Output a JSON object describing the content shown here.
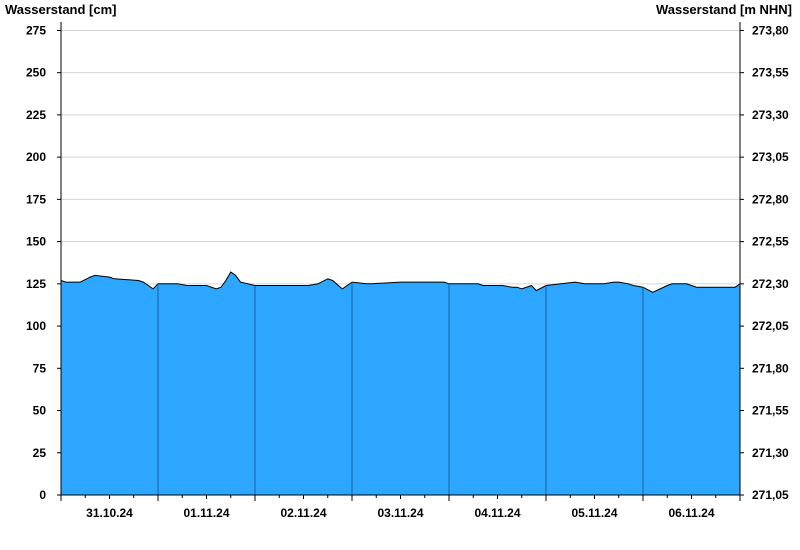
{
  "chart_data": {
    "type": "area",
    "left_axis_title": "Wasserstand [cm]",
    "right_axis_title": "Wasserstand [m NHN]",
    "ylim": [
      0,
      280
    ],
    "right_ylim": [
      271.05,
      273.85
    ],
    "y_ticks": [
      0,
      25,
      50,
      75,
      100,
      125,
      150,
      175,
      200,
      225,
      250,
      275
    ],
    "right_y_ticks": [
      "271,05",
      "271,30",
      "271,55",
      "271,80",
      "272,05",
      "272,30",
      "272,55",
      "272,80",
      "273,05",
      "273,30",
      "273,55",
      "273,80"
    ],
    "x_range_days": [
      0,
      7
    ],
    "x_ticks": [
      "31.10.24",
      "01.11.24",
      "02.11.24",
      "03.11.24",
      "04.11.24",
      "05.11.24",
      "06.11.24"
    ],
    "grid": "horizontal",
    "fill_color": "#2ca6ff",
    "series": [
      {
        "x": [
          0.0,
          0.05,
          0.2,
          0.3,
          0.35,
          0.5,
          0.55,
          0.8,
          0.85,
          0.9,
          0.95,
          1.0,
          1.2,
          1.3,
          1.45,
          1.5,
          1.6,
          1.65,
          1.7,
          1.75,
          1.8,
          1.85,
          2.0,
          2.1,
          2.2,
          2.3,
          2.45,
          2.55,
          2.65,
          2.75,
          2.8,
          2.9,
          3.0,
          3.15,
          3.2,
          3.5,
          3.7,
          3.75,
          3.95,
          4.0,
          4.3,
          4.35,
          4.55,
          4.65,
          4.7,
          4.75,
          4.85,
          4.9,
          5.0,
          5.3,
          5.4,
          5.6,
          5.7,
          5.75,
          5.85,
          5.9,
          6.0,
          6.1,
          6.25,
          6.3,
          6.45,
          6.5,
          6.55,
          6.6,
          6.7,
          6.75,
          6.8,
          6.9,
          6.95,
          7.0
        ],
        "values": [
          127,
          126,
          126,
          129,
          130,
          129,
          128,
          127,
          126,
          124,
          122,
          125,
          125,
          124,
          124,
          124,
          122,
          123,
          127,
          132,
          130,
          126,
          124,
          124,
          124,
          124,
          124,
          124,
          125,
          128,
          127,
          122,
          126,
          125,
          125,
          126,
          126,
          126,
          126,
          125,
          125,
          124,
          124,
          123,
          123,
          122,
          124,
          121,
          124,
          126,
          125,
          125,
          126,
          126,
          125,
          124,
          123,
          120,
          124,
          125,
          125,
          124,
          123,
          123,
          123,
          123,
          123,
          123,
          123,
          125
        ]
      }
    ]
  }
}
